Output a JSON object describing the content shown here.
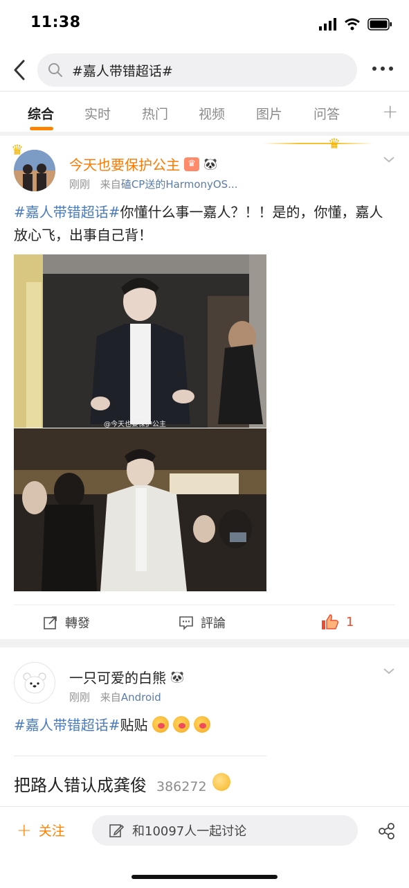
{
  "status": {
    "time": "11:38"
  },
  "search": {
    "query": "#嘉人带错超话#"
  },
  "tabs": [
    "综合",
    "实时",
    "热门",
    "视频",
    "图片",
    "问答"
  ],
  "posts": [
    {
      "user": "今天也要保护公主",
      "time": "刚刚",
      "source_prefix": "来自",
      "source": "磕CP送的HarmonyOS...",
      "hashtag": "#嘉人带错超话#",
      "text": "你懂什么事一嘉人？！！是的，你懂，嘉人放心飞，出事自己背！",
      "image_watermark": "@今天也要保护公主",
      "actions": {
        "repost": "轉發",
        "comment": "評論",
        "like_count": "1"
      }
    },
    {
      "user": "一只可爱的白熊",
      "time": "刚刚",
      "source_prefix": "来自",
      "source": "Android",
      "hashtag": "#嘉人带错超话#",
      "text": "贴贴"
    }
  ],
  "hot_topic": {
    "text": "把路人错认成龚俊",
    "count": "386272"
  },
  "bottom": {
    "follow": "关注",
    "discuss": "和10097人一起讨论"
  },
  "colors": {
    "accent": "#ff8200",
    "link": "#4a7bbf",
    "like": "#f04b2f"
  }
}
